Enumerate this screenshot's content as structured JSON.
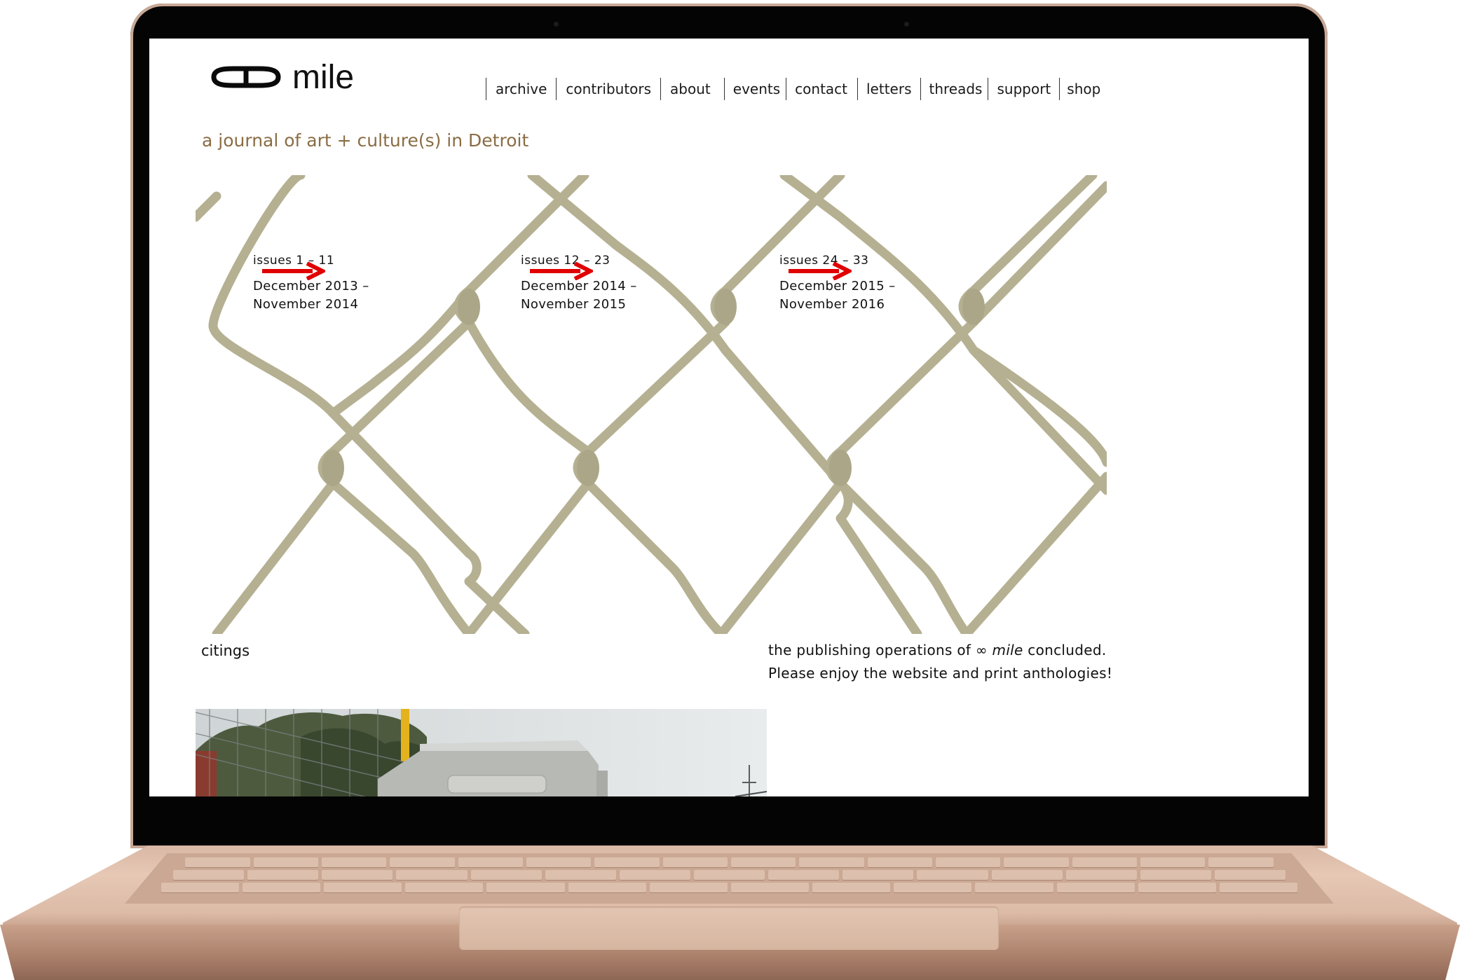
{
  "site": {
    "logo_symbol": "∞",
    "logo_text": "mile",
    "tagline": "a journal of art + culture(s) in Detroit"
  },
  "nav": {
    "items": [
      {
        "label": "archive"
      },
      {
        "label": "contributors"
      },
      {
        "label": "about"
      },
      {
        "label": "events"
      },
      {
        "label": "contact"
      },
      {
        "label": "letters"
      },
      {
        "label": "threads"
      },
      {
        "label": "support"
      },
      {
        "label": "shop"
      }
    ]
  },
  "issues": [
    {
      "range": "issues 1 – 11",
      "dates_line1": "December 2013 –",
      "dates_line2": "November 2014",
      "arrow_icon": "red-right-arrow-icon"
    },
    {
      "range": "issues 12 – 23",
      "dates_line1": "December 2014 –",
      "dates_line2": "November 2015",
      "arrow_icon": "red-right-arrow-icon"
    },
    {
      "range": "issues 24 – 33",
      "dates_line1": "December 2015 –",
      "dates_line2": "November 2016",
      "arrow_icon": "red-right-arrow-icon"
    }
  ],
  "footer": {
    "citings_label": "citings",
    "notice_before": "the publishing operations of ",
    "notice_symbol": "∞",
    "notice_italic": "mile",
    "notice_after": " concluded.",
    "notice_line2": "Please enjoy the website and print anthologies!"
  },
  "colors": {
    "tagline": "#8a6d44",
    "arrow": "#e00000",
    "fence_wire": "#b4b091",
    "laptop_body": "#dcbba7"
  }
}
